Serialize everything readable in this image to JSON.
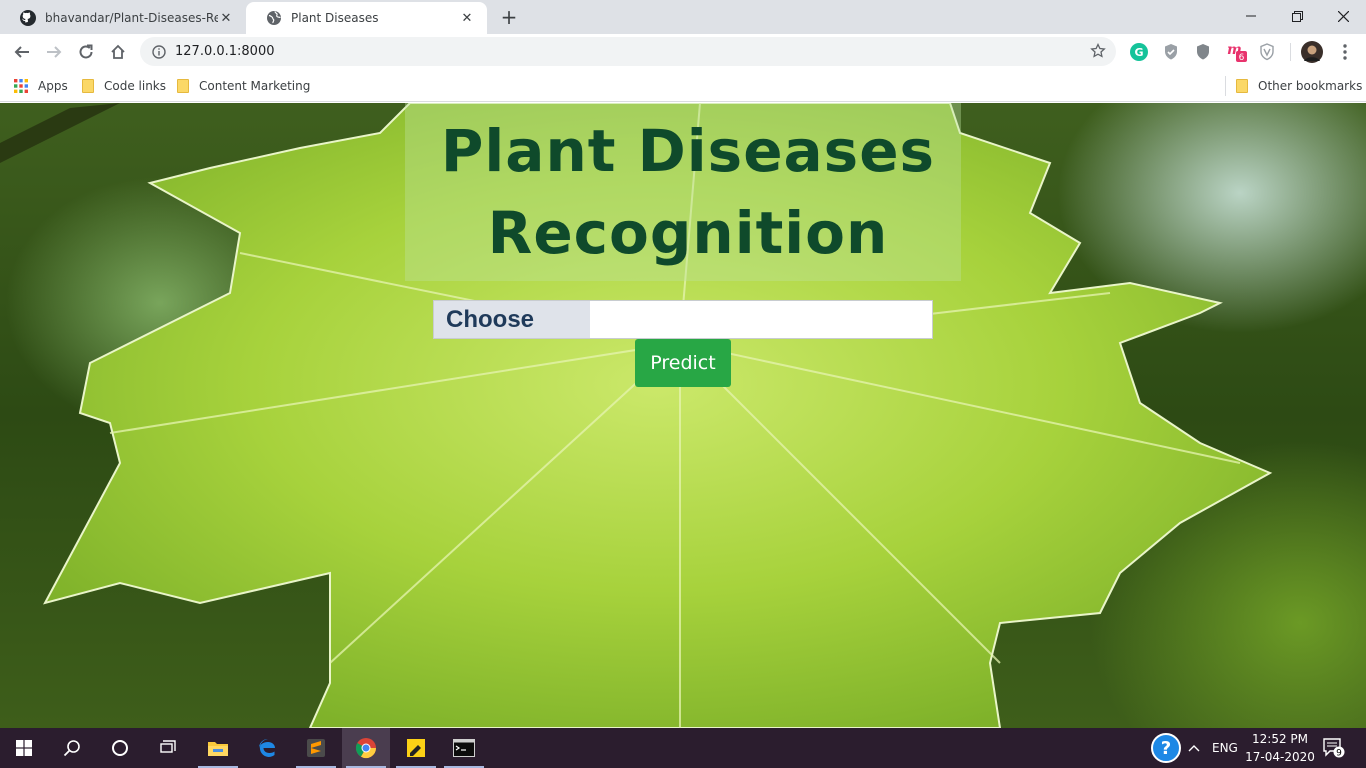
{
  "browser": {
    "tabs": [
      {
        "title": "bhavandar/Plant-Diseases-Recognition",
        "favicon": "github-icon"
      },
      {
        "title": "Plant Diseases",
        "favicon": "globe-icon"
      }
    ],
    "url": "127.0.0.1:8000",
    "extensions": [
      "grammarly-icon",
      "shield-check-icon",
      "shield-icon",
      "mail-extension-icon",
      "vpn-shield-icon",
      "profile-avatar"
    ],
    "extension_badge": "6"
  },
  "bookmarks": {
    "apps_label": "Apps",
    "items": [
      "Code links",
      "Content Marketing"
    ],
    "other_label": "Other bookmarks"
  },
  "page": {
    "title_line1": "Plant Diseases",
    "title_line2": "Recognition",
    "choose_label": "Choose",
    "file_value": "",
    "predict_label": "Predict"
  },
  "taskbar": {
    "apps": [
      "windows-start-icon",
      "search-icon",
      "cortana-icon",
      "task-view-icon",
      "file-explorer-icon",
      "edge-icon",
      "sublime-icon",
      "chrome-icon",
      "sticky-notes-icon",
      "terminal-icon"
    ],
    "language": "ENG",
    "time": "12:52 PM",
    "date": "17-04-2020",
    "notification_count": "9"
  },
  "colors": {
    "title_text": "#0f4a2b",
    "predict_button": "#28a745",
    "choose_label_bg": "#dfe3ea",
    "taskbar_bg": "#2b1d2e"
  }
}
